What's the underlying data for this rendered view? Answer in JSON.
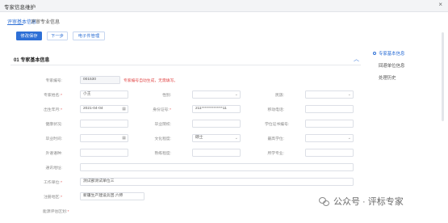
{
  "window": {
    "title": "专家信息维护",
    "close_glyph": "×"
  },
  "tabs": [
    {
      "label": "评审基本信息",
      "active": true
    },
    {
      "label": "评审专业信息",
      "active": false
    }
  ],
  "toolbar": {
    "save_label": "修改保存",
    "next_label": "下一步",
    "e_doc_label": "电子件管理"
  },
  "section": {
    "title": "01  专家基本信息",
    "collapse_glyph": "︿"
  },
  "fields": {
    "expert_no": {
      "label": "专家编号:",
      "value": "001530",
      "hint": "专家编号自动生成，无需填写。"
    },
    "name": {
      "label": "专家姓名:",
      "value": "小王"
    },
    "gender": {
      "label": "性别:",
      "value": ""
    },
    "ethnicity": {
      "label": "民族:",
      "value": ""
    },
    "birth": {
      "label": "出生年月:",
      "value": "2021-04-04"
    },
    "id_no": {
      "label": "身份证号:",
      "value": "211**************11"
    },
    "phone": {
      "label": "移动电话:",
      "value": ""
    },
    "health": {
      "label": "健康状况:",
      "value": ""
    },
    "graduated_school": {
      "label": "毕业院校:",
      "value": ""
    },
    "degree_cert": {
      "label": "学位证书编号:",
      "value": ""
    },
    "graduation_time": {
      "label": "毕业时间:",
      "value": ""
    },
    "education": {
      "label": "文化程度:",
      "value": "硕士"
    },
    "highest_degree": {
      "label": "最高学位:",
      "value": ""
    },
    "foreign_lang": {
      "label": "外语语种:",
      "value": ""
    },
    "proficiency": {
      "label": "熟练程度:",
      "value": ""
    },
    "major": {
      "label": "所学专业:",
      "value": ""
    },
    "address": {
      "label": "通讯地址:",
      "value": ""
    },
    "employer": {
      "label": "工作单位:",
      "value": "测试部测试单位三"
    },
    "registered_area": {
      "label": "注册地区:",
      "value": "新疆生产建设兵团.六师"
    },
    "eval_area": {
      "label": "能源评估区划:",
      "value": ""
    }
  },
  "side_nav": [
    {
      "label": "专家基本信息",
      "active": true
    },
    {
      "label": "回避单位信息",
      "active": false
    },
    {
      "label": "处理历史",
      "active": false
    }
  ],
  "icons": {
    "calendar": "▦",
    "dropdown": "⌄"
  },
  "watermark": {
    "text": "公众号 · 评标专家"
  },
  "colors": {
    "accent": "#2d6fd6",
    "required": "#e24b4b"
  }
}
